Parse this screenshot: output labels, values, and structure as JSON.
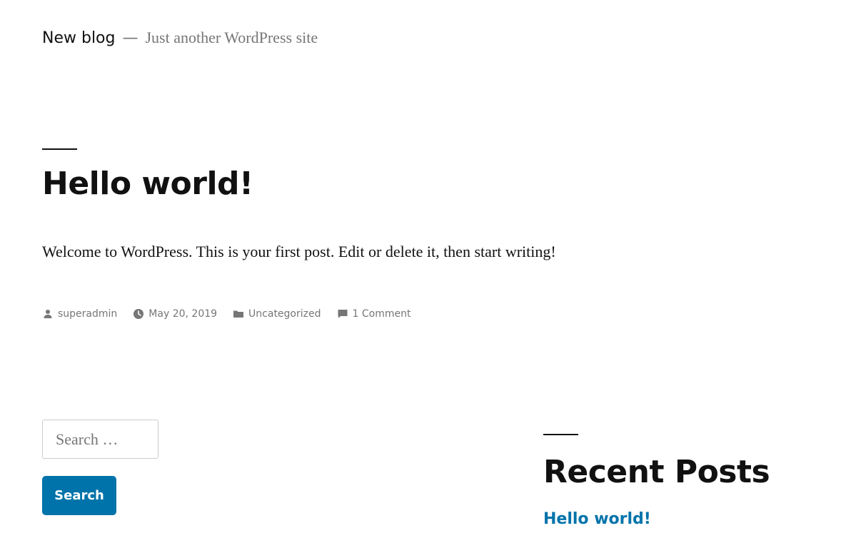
{
  "header": {
    "site_title": "New blog",
    "separator": "—",
    "tagline": "Just another WordPress site"
  },
  "post": {
    "title": "Hello world!",
    "content": "Welcome to WordPress. This is your first post. Edit or delete it, then start writing!",
    "meta": {
      "author_icon": "person-icon",
      "author": "superadmin",
      "date_icon": "clock-icon",
      "date": "May 20, 2019",
      "category_icon": "folder-icon",
      "category": "Uncategorized",
      "comments_icon": "comment-icon",
      "comments": "1 Comment"
    }
  },
  "sidebar": {
    "search": {
      "placeholder": "Search …",
      "button_label": "Search"
    },
    "recent_posts": {
      "title": "Recent Posts",
      "items": [
        {
          "label": "Hello world!"
        }
      ]
    }
  },
  "colors": {
    "accent": "#0073aa",
    "text": "#111111",
    "muted": "#767676"
  }
}
